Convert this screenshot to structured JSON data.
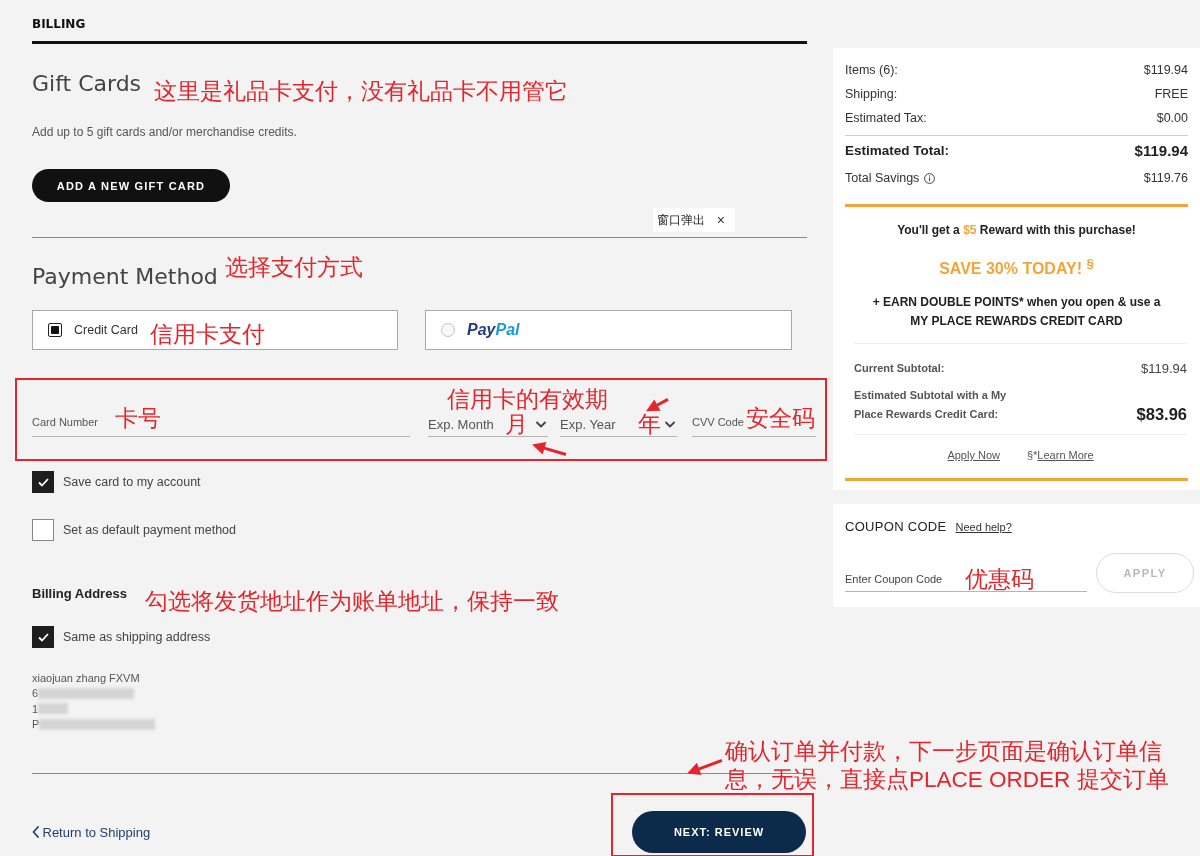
{
  "section_title": "BILLING",
  "gift_cards": {
    "title": "Gift Cards",
    "note": "这里是礼品卡支付，没有礼品卡不用管它",
    "description": "Add up to 5 gift cards and/or merchandise credits.",
    "button": "ADD A NEW GIFT CARD"
  },
  "popup": {
    "label": "窗口弹出",
    "close": "×"
  },
  "payment": {
    "title": "Payment Method",
    "note": "选择支付方式",
    "options": [
      {
        "kind": "text",
        "label": "Credit Card",
        "note": "信用卡支付",
        "selected": true
      },
      {
        "kind": "logo",
        "logo": [
          "Pay",
          "Pal"
        ],
        "selected": false
      }
    ]
  },
  "card_fields": {
    "card_number": {
      "placeholder": "Card Number",
      "note": "卡号"
    },
    "expiry_note": "信用卡的有效期",
    "exp_month": {
      "label": "Exp. Month",
      "note": "月"
    },
    "exp_year": {
      "label": "Exp. Year",
      "note": "年"
    },
    "cvv": {
      "placeholder": "CVV Code",
      "note": "安全码"
    }
  },
  "checkboxes": [
    {
      "label": "Save card to my account",
      "checked": true
    },
    {
      "label": "Set as default payment method",
      "checked": false
    }
  ],
  "billing_address": {
    "title": "Billing Address",
    "note": "勾选将发货地址作为账单地址，保持一致",
    "same_as_shipping": {
      "label": "Same as shipping address",
      "checked": true
    },
    "lines": [
      {
        "text": "xiaojuan zhang FXVM",
        "redacted": false
      },
      {
        "text": "6",
        "redacted": true
      },
      {
        "text": "1",
        "redacted": true
      },
      {
        "text": "P",
        "redacted": true
      }
    ]
  },
  "footer": {
    "back_link": "Return to Shipping",
    "next_button": "NEXT: REVIEW",
    "note": "确认订单并付款，下一步页面是确认订单信息，无误，直接点PLACE ORDER 提交订单"
  },
  "summary": {
    "rows": [
      {
        "label": "Items (6):",
        "value": "$119.94"
      },
      {
        "label": "Shipping:",
        "value": "FREE"
      },
      {
        "label": "Estimated Tax:",
        "value": "$0.00"
      }
    ],
    "total": {
      "label": "Estimated Total:",
      "value": "$119.94"
    },
    "savings": {
      "label": "Total Savings",
      "value": "$119.76"
    },
    "reward": {
      "before": "You'll get a ",
      "amount": "$5",
      "after": " Reward with this purchase!"
    },
    "promo": "SAVE 30% TODAY! $^{§}$",
    "offer": "+ EARN DOUBLE POINTS* when you open & use a MY PLACE REWARDS CREDIT CARD",
    "subtotals": [
      {
        "label": "Current Subtotal:",
        "value": "$119.94",
        "emphasis": false
      },
      {
        "label": "Estimated Subtotal with a My Place Rewards Credit Card:",
        "value": "$83.96",
        "emphasis": true
      }
    ],
    "links": {
      "apply": "Apply Now",
      "footnote": "§*",
      "learn_more": "Learn More"
    }
  },
  "coupon": {
    "title": "COUPON CODE",
    "help_link": "Need help?",
    "placeholder": "Enter Coupon Code",
    "note": "优惠码",
    "button": "APPLY",
    "disabled": true
  }
}
